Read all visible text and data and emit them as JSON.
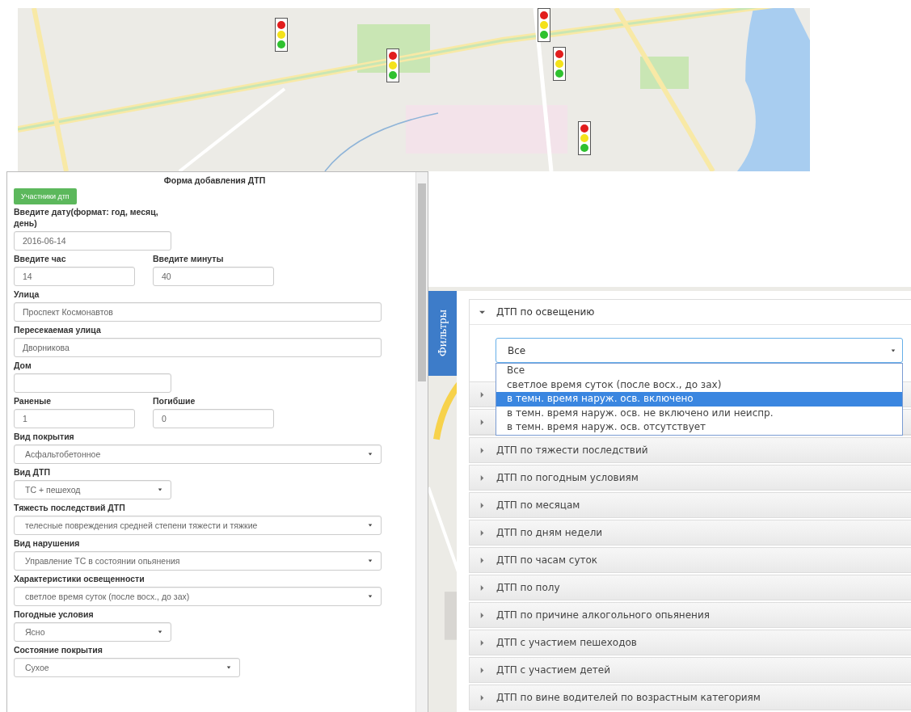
{
  "form": {
    "title": "Форма добавления ДТП",
    "participants_button": "Участники дтп",
    "rows": [
      {
        "fields": [
          {
            "kind": "input",
            "label": "Введите дату(формат: год, месяц, день)",
            "value": "2016-06-14"
          }
        ]
      },
      {
        "fields": [
          {
            "kind": "input",
            "label": "Введите час",
            "value": "14"
          },
          {
            "kind": "input",
            "label": "Введите минуты",
            "value": "40"
          }
        ]
      },
      {
        "fields": [
          {
            "kind": "input",
            "label": "Улица",
            "value": "Проспект Космонавтов"
          }
        ]
      },
      {
        "fields": [
          {
            "kind": "input",
            "label": "Пересекаемая улица",
            "value": "Дворникова"
          }
        ]
      },
      {
        "fields": [
          {
            "kind": "input",
            "label": "Дом"
          }
        ]
      },
      {
        "fields": [
          {
            "kind": "input",
            "label": "Раненые",
            "value": "1"
          },
          {
            "kind": "input",
            "label": "Погибшие",
            "value": "0"
          }
        ]
      },
      {
        "fields": [
          {
            "kind": "select",
            "label": "Вид покрытия",
            "value": "Асфальтобетонное"
          }
        ]
      },
      {
        "fields": [
          {
            "kind": "select",
            "label": "Вид ДТП",
            "value": "ТС + пешеход"
          }
        ]
      },
      {
        "fields": [
          {
            "kind": "select",
            "label": "Тяжесть последствий ДТП",
            "value": "телесные повреждения средней степени тяжести и тяжкие"
          }
        ]
      },
      {
        "fields": [
          {
            "kind": "select",
            "label": "Вид нарушения",
            "value": "Управление ТС в состоянии опьянения"
          }
        ]
      },
      {
        "fields": [
          {
            "kind": "select",
            "label": "Характеристики освещенности",
            "value": "светлое время суток (после восх., до зах)"
          }
        ]
      },
      {
        "fields": [
          {
            "kind": "select",
            "label": "Погодные условия",
            "value": "Ясно"
          }
        ]
      },
      {
        "fields": [
          {
            "kind": "select",
            "label": "Состояние покрытия",
            "value": "Сухое"
          }
        ]
      }
    ]
  },
  "filters": {
    "tab_label": "Фильтры",
    "items": [
      {
        "label": "ДТП по освещению",
        "expanded": true,
        "select_value": "Все",
        "options": [
          {
            "label": "Все",
            "selected": false
          },
          {
            "label": "светлое время суток (после восх., до зах)",
            "selected": false
          },
          {
            "label": "в темн. время наруж. осв. включено",
            "selected": true
          },
          {
            "label": "в темн. время наруж. осв. не включено или неиспр.",
            "selected": false
          },
          {
            "label": "в темн. время наруж. осв. отсутствует",
            "selected": false
          }
        ]
      },
      {
        "label": "ДТП по тяжести последствий",
        "expanded": false
      },
      {
        "label": "ДТП по погодным условиям",
        "expanded": false
      },
      {
        "label": "ДТП по месяцам",
        "expanded": false
      },
      {
        "label": "ДТП по дням недели",
        "expanded": false
      },
      {
        "label": "ДТП по часам суток",
        "expanded": false
      },
      {
        "label": "ДТП по полу",
        "expanded": false
      },
      {
        "label": "ДТП по причине алкогольного опьянения",
        "expanded": false
      },
      {
        "label": "ДТП с участием пешеходов",
        "expanded": false
      },
      {
        "label": "ДТП с участием детей",
        "expanded": false
      },
      {
        "label": "ДТП по вине водителей по возрастным категориям",
        "expanded": false
      }
    ]
  }
}
